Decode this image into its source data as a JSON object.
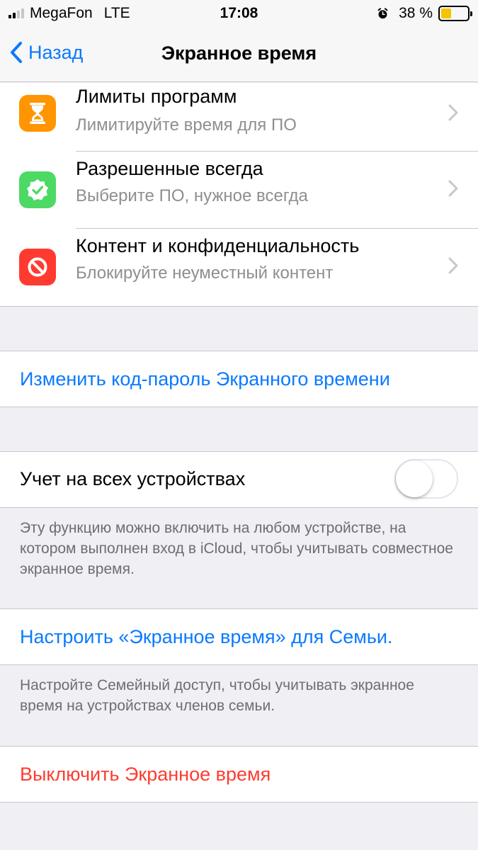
{
  "status_bar": {
    "carrier": "MegaFon",
    "network": "LTE",
    "time": "17:08",
    "battery_percent": "38 %",
    "battery_level": 0.38,
    "battery_color": "#f5c400",
    "signal_bars_filled": 2,
    "signal_bars_total": 4,
    "alarm_icon": "alarm-clock-icon"
  },
  "nav": {
    "back_label": "Назад",
    "title": "Экранное время"
  },
  "menu_items": [
    {
      "title": "Лимиты программ",
      "subtitle": "Лимитируйте время для ПО",
      "icon": "hourglass-icon",
      "icon_bg": "#ff9500"
    },
    {
      "title": "Разрешенные всегда",
      "subtitle": "Выберите ПО, нужное всегда",
      "icon": "checkmark-badge-icon",
      "icon_bg": "#4cd964"
    },
    {
      "title": "Контент и конфиденциальность",
      "subtitle": "Блокируйте неуместный контент",
      "icon": "prohibited-icon",
      "icon_bg": "#ff3b30"
    }
  ],
  "change_passcode_label": "Изменить код-пароль Экранного времени",
  "share_across_devices": {
    "label": "Учет на всех устройствах",
    "enabled": false,
    "footnote": "Эту функцию можно включить на любом устройстве, на котором выполнен вход в iCloud, чтобы учитывать совместное экранное время."
  },
  "family": {
    "label": "Настроить «Экранное время» для Семьи.",
    "footnote": "Настройте Семейный доступ, чтобы учитывать экранное время на устройствах членов семьи."
  },
  "turn_off_label": "Выключить Экранное время",
  "colors": {
    "accent": "#0a7aff",
    "destructive": "#ff3b30",
    "background": "#efeff4"
  }
}
